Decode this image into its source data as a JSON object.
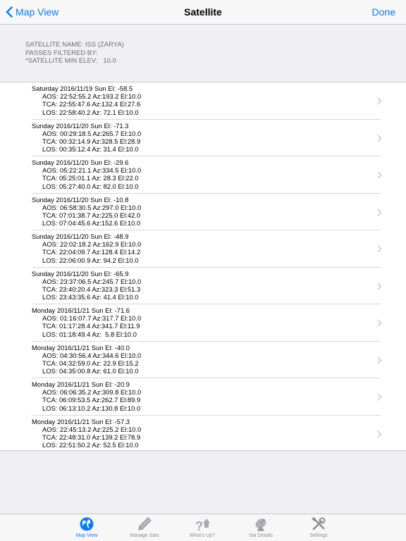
{
  "nav": {
    "back_label": "Map View",
    "title": "Satellite",
    "done_label": "Done"
  },
  "info": {
    "satellite_name": "SATELLITE NAME: ISS (ZARYA)",
    "passes_filtered_by": "PASSES FILTERED BY:",
    "min_elev": "*SATELLITE MIN ELEV:   10.0"
  },
  "passes": [
    {
      "title": "Saturday 2016/11/19 Sun El: -58.5",
      "aos": "AOS: 22:52:55.2 Az:193.2 El:10.0",
      "tca": "TCA: 22:55:47.6 Az:132.4 El:27.6",
      "los": "LOS: 22:58:40.2 Az: 72.1 El:10.0"
    },
    {
      "title": "Sunday 2016/11/20 Sun El: -71.3",
      "aos": "AOS: 00:29:18.5 Az:265.7 El:10.0",
      "tca": "TCA: 00:32:14.9 Az:328.5 El:28.9",
      "los": "LOS: 00:35:12.4 Az: 31.4 El:10.0"
    },
    {
      "title": "Sunday 2016/11/20 Sun El: -29.6",
      "aos": "AOS: 05:22:21.1 Az:334.5 El:10.0",
      "tca": "TCA: 05:25:01.1 Az: 28.3 El:22.0",
      "los": "LOS: 05:27:40.0 Az: 82.0 El:10.0"
    },
    {
      "title": "Sunday 2016/11/20 Sun El: -10.8",
      "aos": "AOS: 06:58:30.5 Az:297.0 El:10.0",
      "tca": "TCA: 07:01:38.7 Az:225.0 El:42.0",
      "los": "LOS: 07:04:45.6 Az:152.6 El:10.0"
    },
    {
      "title": "Sunday 2016/11/20 Sun El: -48.9",
      "aos": "AOS: 22:02:18.2 Az:162.9 El:10.0",
      "tca": "TCA: 22:04:09.7 Az:128.4 El:14.2",
      "los": "LOS: 22:06:00.9 Az: 94.2 El:10.0"
    },
    {
      "title": "Sunday 2016/11/20 Sun El: -65.9",
      "aos": "AOS: 23:37:06.5 Az:245.7 El:10.0",
      "tca": "TCA: 23:40:20.4 Az:323.3 El:51.3",
      "los": "LOS: 23:43:35.6 Az: 41.4 El:10.0"
    },
    {
      "title": "Monday 2016/11/21 Sun El: -71.6",
      "aos": "AOS: 01:16:07.7 Az:317.7 El:10.0",
      "tca": "TCA: 01:17:28.4 Az:341.7 El:11.9",
      "los": "LOS: 01:18:49.4 Az:  5.8 El:10.0"
    },
    {
      "title": "Monday 2016/11/21 Sun El: -40.0",
      "aos": "AOS: 04:30:56.4 Az:344.6 El:10.0",
      "tca": "TCA: 04:32:59.0 Az: 22.9 El:15.2",
      "los": "LOS: 04:35:00.8 Az: 61.0 El:10.0"
    },
    {
      "title": "Monday 2016/11/21 Sun El: -20.9",
      "aos": "AOS: 06:06:35.2 Az:309.8 El:10.0",
      "tca": "TCA: 06:09:53.5 Az:262.7 El:89.9",
      "los": "LOS: 06:13:10.2 Az:130.8 El:10.0"
    },
    {
      "title": "Monday 2016/11/21 Sun El: -57.3",
      "aos": "AOS: 22:45:13.2 Az:225.2 El:10.0",
      "tca": "TCA: 22:48:31.0 Az:139.2 El:78.9",
      "los": "LOS: 22:51:50.2 Az: 52.5 El:10.0"
    }
  ],
  "tabs": [
    {
      "label": "Map View",
      "icon": "globe-icon",
      "active": true
    },
    {
      "label": "Manage Sats",
      "icon": "pencil-icon",
      "active": false
    },
    {
      "label": "What's Up?",
      "icon": "whats-up-icon",
      "active": false
    },
    {
      "label": "Sat Details",
      "icon": "satellite-dish-icon",
      "active": false
    },
    {
      "label": "Settings",
      "icon": "tools-icon",
      "active": false
    }
  ],
  "colors": {
    "accent": "#0a7aff",
    "inactive": "#8e8e93"
  }
}
